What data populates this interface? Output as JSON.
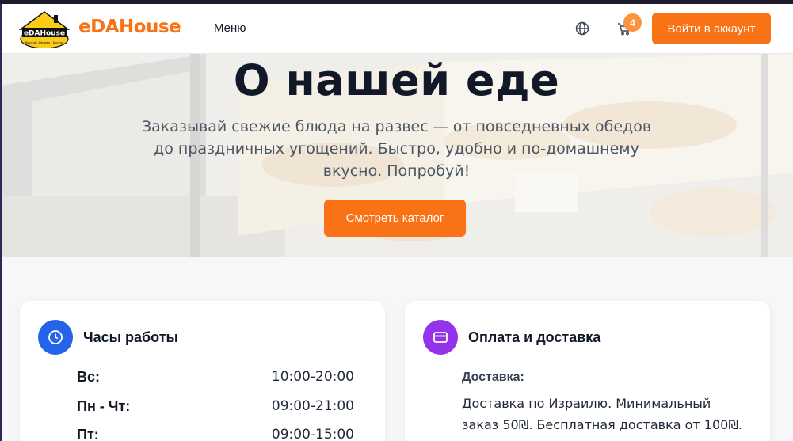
{
  "header": {
    "logo_small_text": "eDAHouse",
    "logo_tagline": "Вкусно | Дёшево | Быстро",
    "brand": "eDAHouse",
    "menu_label": "Меню",
    "cart_count": "4",
    "login_label": "Войти в аккаунт"
  },
  "hero": {
    "title": "О нашей еде",
    "subtitle": "Заказывай свежие блюда на развес — от повседневных обедов до праздничных угощений. Быстро, удобно и по-домашнему вкусно. Попробуй!",
    "cta_label": "Смотреть каталог"
  },
  "hours_card": {
    "title": "Часы работы",
    "rows": [
      {
        "day": "Вс:",
        "time": "10:00-20:00"
      },
      {
        "day": "Пн - Чт:",
        "time": "09:00-21:00"
      },
      {
        "day": "Пт:",
        "time": "09:00-15:00"
      }
    ]
  },
  "payment_card": {
    "title": "Оплата и доставка",
    "delivery_label": "Доставка:",
    "delivery_text": "Доставка по Израилю. Минимальный заказ 50₪. Бесплатная доставка от 100₪."
  },
  "colors": {
    "accent": "#f97316",
    "badge": "#fb923c",
    "hours_icon_bg": "#2563eb",
    "payment_icon_bg": "#9333ea"
  },
  "icons": {
    "globe": "globe-icon",
    "cart": "cart-icon",
    "clock": "clock-icon",
    "card": "credit-card-icon"
  }
}
